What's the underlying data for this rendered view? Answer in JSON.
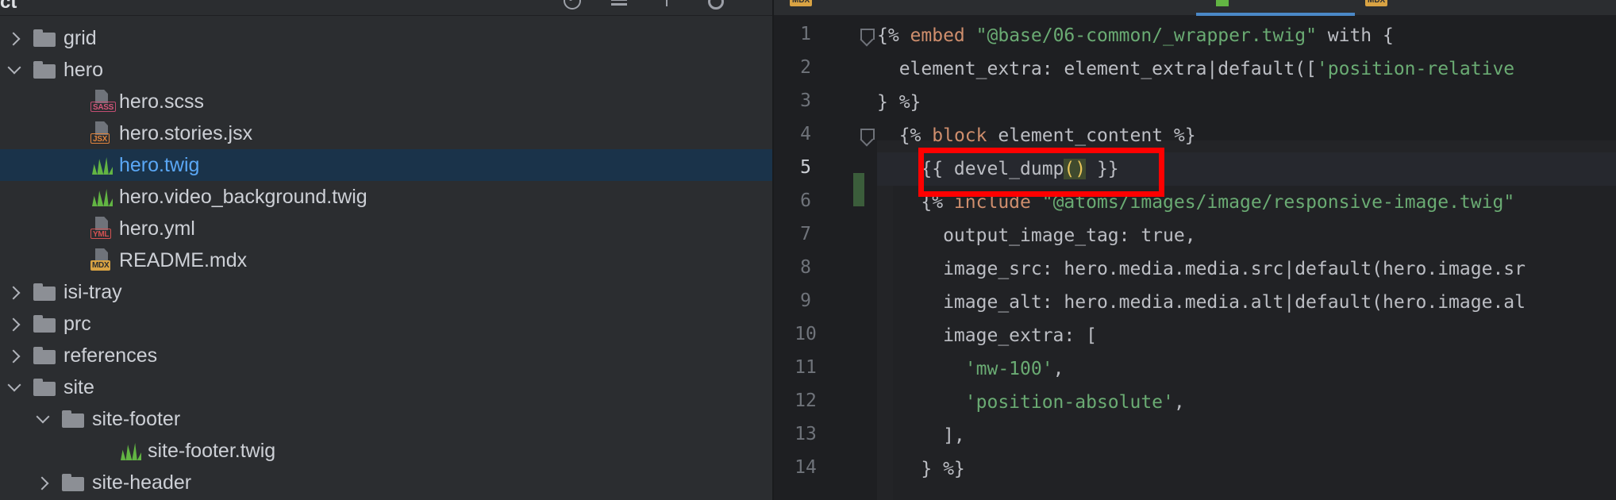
{
  "project_panel": {
    "header_label": "ct",
    "items": [
      {
        "label": "grid",
        "kind": "folder",
        "expanded": false,
        "depth": 0
      },
      {
        "label": "hero",
        "kind": "folder",
        "expanded": true,
        "depth": 0
      },
      {
        "label": "hero.scss",
        "kind": "file",
        "icon": "sass-file-icon",
        "tag": "SASS",
        "depth": 1
      },
      {
        "label": "hero.stories.jsx",
        "kind": "file",
        "icon": "jsx-file-icon",
        "tag": "JSX",
        "depth": 1
      },
      {
        "label": "hero.twig",
        "kind": "twig",
        "icon": "twig-file-icon",
        "selected": true,
        "depth": 1
      },
      {
        "label": "hero.video_background.twig",
        "kind": "twig",
        "icon": "twig-file-icon",
        "depth": 1
      },
      {
        "label": "hero.yml",
        "kind": "file",
        "icon": "yml-file-icon",
        "tag": "YML",
        "depth": 1
      },
      {
        "label": "README.mdx",
        "kind": "file",
        "icon": "mdx-file-icon",
        "tag": "MDX",
        "depth": 1
      },
      {
        "label": "isi-tray",
        "kind": "folder",
        "expanded": false,
        "depth": 0
      },
      {
        "label": "prc",
        "kind": "folder",
        "expanded": false,
        "depth": 0
      },
      {
        "label": "references",
        "kind": "folder",
        "expanded": false,
        "depth": 0
      },
      {
        "label": "site",
        "kind": "folder",
        "expanded": true,
        "depth": 0
      },
      {
        "label": "site-footer",
        "kind": "folder",
        "expanded": true,
        "depth": 1
      },
      {
        "label": "site-footer.twig",
        "kind": "twig",
        "icon": "twig-file-icon",
        "depth": 2
      },
      {
        "label": "site-header",
        "kind": "folder",
        "expanded": false,
        "depth": 1
      }
    ]
  },
  "editor": {
    "tab_tags": [
      "MDX",
      "MDX"
    ],
    "current_line": 5,
    "lines": [
      {
        "n": "1",
        "tokens": [
          [
            "plain",
            "{% "
          ],
          [
            "kw",
            "embed"
          ],
          [
            "plain",
            " "
          ],
          [
            "str",
            "\"@base/06-common/_wrapper.twig\""
          ],
          [
            "plain",
            " with {"
          ]
        ]
      },
      {
        "n": "2",
        "tokens": [
          [
            "plain",
            "  element_extra: element_extra|default(["
          ],
          [
            "str",
            "'position-relative"
          ]
        ]
      },
      {
        "n": "3",
        "tokens": [
          [
            "plain",
            "} %}"
          ]
        ]
      },
      {
        "n": "4",
        "tokens": [
          [
            "plain",
            "  {% "
          ],
          [
            "kw",
            "block"
          ],
          [
            "plain",
            " element_content %}"
          ]
        ]
      },
      {
        "n": "5",
        "tokens": [
          [
            "plain",
            "    {{ devel_dump"
          ],
          [
            "paren",
            "()"
          ],
          [
            "plain",
            " }}"
          ]
        ]
      },
      {
        "n": "6",
        "tokens": [
          [
            "plain",
            "    {% "
          ],
          [
            "kw",
            "include"
          ],
          [
            "plain",
            " "
          ],
          [
            "str",
            "\"@atoms/images/image/responsive-image.twig\""
          ]
        ]
      },
      {
        "n": "7",
        "tokens": [
          [
            "plain",
            "      output_image_tag: true,"
          ]
        ]
      },
      {
        "n": "8",
        "tokens": [
          [
            "plain",
            "      image_src: hero.media.media.src|default(hero.image.sr"
          ]
        ]
      },
      {
        "n": "9",
        "tokens": [
          [
            "plain",
            "      image_alt: hero.media.media.alt|default(hero.image.al"
          ]
        ]
      },
      {
        "n": "10",
        "tokens": [
          [
            "plain",
            "      image_extra: ["
          ]
        ]
      },
      {
        "n": "11",
        "tokens": [
          [
            "plain",
            "        "
          ],
          [
            "str",
            "'mw-100'"
          ],
          [
            "plain",
            ","
          ]
        ]
      },
      {
        "n": "12",
        "tokens": [
          [
            "plain",
            "        "
          ],
          [
            "str",
            "'position-absolute'"
          ],
          [
            "plain",
            ","
          ]
        ]
      },
      {
        "n": "13",
        "tokens": [
          [
            "plain",
            "      ],"
          ]
        ]
      },
      {
        "n": "14",
        "tokens": [
          [
            "plain",
            "    } %}"
          ]
        ]
      }
    ]
  },
  "colors": {
    "selection": "#1a334a",
    "highlight_box": "#ff0000",
    "keyword": "#cf8e6d",
    "string": "#6aab73"
  }
}
